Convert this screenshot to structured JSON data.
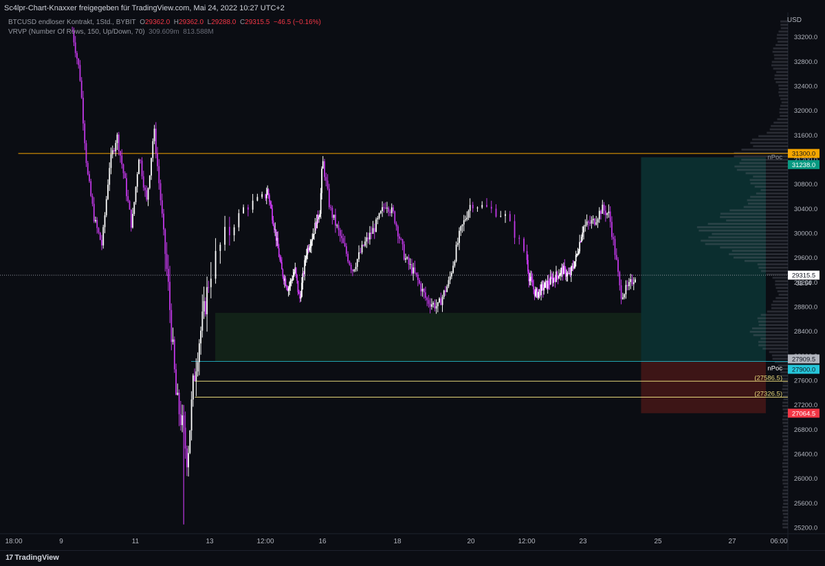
{
  "header": {
    "shared_by": "Sc4lpr-Chart-Knaxxer freigegeben für TradingView.com, Mai 24, 2022 10:27 UTC+2"
  },
  "legend": {
    "symbol": "BTCUSD endloser Kontrakt, 1Std., BYBIT",
    "open_label": "O",
    "open": "29362.0",
    "high_label": "H",
    "high": "29362.0",
    "low_label": "L",
    "low": "29288.0",
    "close_label": "C",
    "close": "29315.5",
    "change": "−46.5 (−0.16%)",
    "indicator": "VRVP (Number Of Rows, 150, Up/Down, 70)",
    "ind_values": "309.609m",
    "ind_values2": "813.588M"
  },
  "axis": {
    "currency": "USD"
  },
  "branding": {
    "logo_text": "TradingView",
    "logo_mark": "17"
  },
  "colors": {
    "background": "#0b0d13",
    "candle_up": "#ffffff",
    "candle_down": "#c238e8",
    "resistance": "#f7a600",
    "target_zone": "#0c3a3a",
    "stop_zone": "#4a1818",
    "demand_zone": "#13251a",
    "cyan": "#26c6da",
    "yellow_line": "#e8d87a",
    "stop_badge": "#f23645",
    "target_badge": "#089981"
  },
  "chart_data": {
    "type": "candlestick",
    "symbol": "BTCUSD",
    "timeframe": "1h",
    "ylim": [
      25100,
      33600
    ],
    "y_ticks": [
      25200,
      25600,
      26000,
      26400,
      26800,
      27200,
      27600,
      28000,
      28400,
      28800,
      29200,
      29600,
      30000,
      30400,
      30800,
      31200,
      31600,
      32000,
      32400,
      32800,
      33200
    ],
    "x_ticks": [
      "18:00",
      "9",
      "11",
      "13",
      "12:00",
      "16",
      "18",
      "20",
      "12:00",
      "23",
      "25",
      "27",
      "06:00"
    ],
    "price_path": [
      [
        9.3,
        33300
      ],
      [
        9.5,
        32600
      ],
      [
        9.7,
        31000
      ],
      [
        9.9,
        30200
      ],
      [
        10.1,
        29800
      ],
      [
        10.3,
        31100
      ],
      [
        10.5,
        31600
      ],
      [
        10.7,
        30900
      ],
      [
        10.9,
        30100
      ],
      [
        11.1,
        31300
      ],
      [
        11.3,
        30500
      ],
      [
        11.5,
        31700
      ],
      [
        11.7,
        30400
      ],
      [
        11.9,
        29000
      ],
      [
        12.1,
        27300
      ],
      [
        12.25,
        26900
      ],
      [
        12.4,
        26300
      ],
      [
        12.55,
        27500
      ],
      [
        12.7,
        28200
      ],
      [
        12.9,
        28900
      ],
      [
        13.1,
        29800
      ],
      [
        13.3,
        30400
      ],
      [
        13.6,
        30700
      ],
      [
        13.9,
        30100
      ],
      [
        14.2,
        29400
      ],
      [
        14.5,
        29100
      ],
      [
        14.8,
        29400
      ],
      [
        15.0,
        28900
      ],
      [
        15.3,
        29700
      ],
      [
        15.6,
        30000
      ],
      [
        15.9,
        30400
      ],
      [
        16.0,
        31200
      ],
      [
        16.2,
        30400
      ],
      [
        16.5,
        29900
      ],
      [
        16.8,
        29400
      ],
      [
        17.1,
        29800
      ],
      [
        17.4,
        30100
      ],
      [
        17.7,
        30500
      ],
      [
        17.9,
        30300
      ],
      [
        18.2,
        29600
      ],
      [
        18.5,
        29300
      ],
      [
        18.8,
        28900
      ],
      [
        19.1,
        28800
      ],
      [
        19.4,
        29200
      ],
      [
        19.7,
        30000
      ],
      [
        20.0,
        30500
      ],
      [
        20.3,
        30300
      ],
      [
        20.6,
        29300
      ],
      [
        20.9,
        29000
      ],
      [
        21.2,
        29100
      ],
      [
        21.5,
        29200
      ],
      [
        21.8,
        29300
      ],
      [
        22.1,
        29400
      ],
      [
        22.4,
        29300
      ],
      [
        22.7,
        29600
      ],
      [
        23.0,
        30100
      ],
      [
        23.3,
        30200
      ],
      [
        23.5,
        30400
      ],
      [
        23.7,
        30300
      ],
      [
        23.9,
        29500
      ],
      [
        24.0,
        29000
      ],
      [
        24.2,
        29100
      ],
      [
        24.4,
        29315.5
      ]
    ],
    "levels": [
      {
        "price": 31300.0,
        "label": "31300.0"
      },
      {
        "price": 31238.0,
        "label": "31238.0",
        "annotation": "nPoc"
      },
      {
        "price": 29315.5,
        "label": "29315.5",
        "sublabel": "32:54"
      },
      {
        "price": 27909.5,
        "label": "27909.5"
      },
      {
        "price": 27900.0,
        "label": "27900.0",
        "annotation": "nPoc"
      },
      {
        "price": 27586.5,
        "label": "(27586.5)"
      },
      {
        "price": 27326.5,
        "label": "(27326.5)"
      },
      {
        "price": 27064.5,
        "label": "27064.5"
      }
    ],
    "zones": [
      {
        "kind": "demand",
        "from_price": 27909.5,
        "to_price": 28700
      },
      {
        "kind": "target",
        "from_price": 27909.5,
        "to_price": 31238.0
      },
      {
        "kind": "stop",
        "from_price": 27064.5,
        "to_price": 27909.5
      }
    ],
    "volume_profile_poc": 30000
  }
}
